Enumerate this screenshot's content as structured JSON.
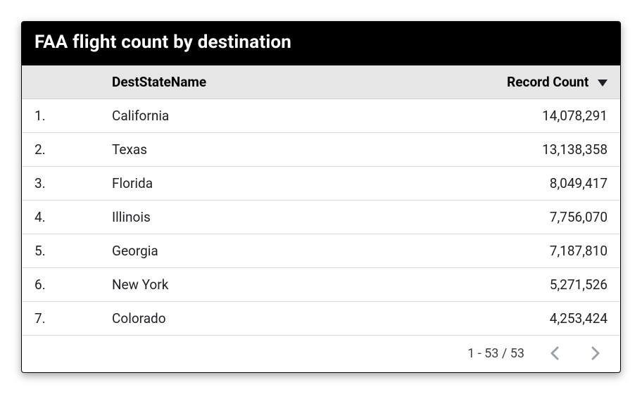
{
  "card": {
    "title": "FAA flight count by destination"
  },
  "table": {
    "columns": {
      "index": "",
      "dest": "DestStateName",
      "count": "Record Count"
    },
    "sort": {
      "column": "count",
      "direction": "desc"
    },
    "rows": [
      {
        "idx": "1.",
        "dest": "California",
        "count": "14,078,291"
      },
      {
        "idx": "2.",
        "dest": "Texas",
        "count": "13,138,358"
      },
      {
        "idx": "3.",
        "dest": "Florida",
        "count": "8,049,417"
      },
      {
        "idx": "4.",
        "dest": "Illinois",
        "count": "7,756,070"
      },
      {
        "idx": "5.",
        "dest": "Georgia",
        "count": "7,187,810"
      },
      {
        "idx": "6.",
        "dest": "New York",
        "count": "5,271,526"
      },
      {
        "idx": "7.",
        "dest": "Colorado",
        "count": "4,253,424"
      }
    ]
  },
  "pager": {
    "range_text": "1 - 53 / 53"
  },
  "chart_data": {
    "type": "table",
    "title": "FAA flight count by destination",
    "columns": [
      "DestStateName",
      "Record Count"
    ],
    "sort": {
      "column": "Record Count",
      "direction": "desc"
    },
    "total_rows": 53,
    "visible_range": [
      1,
      7
    ],
    "rows": [
      {
        "DestStateName": "California",
        "Record Count": 14078291
      },
      {
        "DestStateName": "Texas",
        "Record Count": 13138358
      },
      {
        "DestStateName": "Florida",
        "Record Count": 8049417
      },
      {
        "DestStateName": "Illinois",
        "Record Count": 7756070
      },
      {
        "DestStateName": "Georgia",
        "Record Count": 7187810
      },
      {
        "DestStateName": "New York",
        "Record Count": 5271526
      },
      {
        "DestStateName": "Colorado",
        "Record Count": 4253424
      }
    ]
  }
}
